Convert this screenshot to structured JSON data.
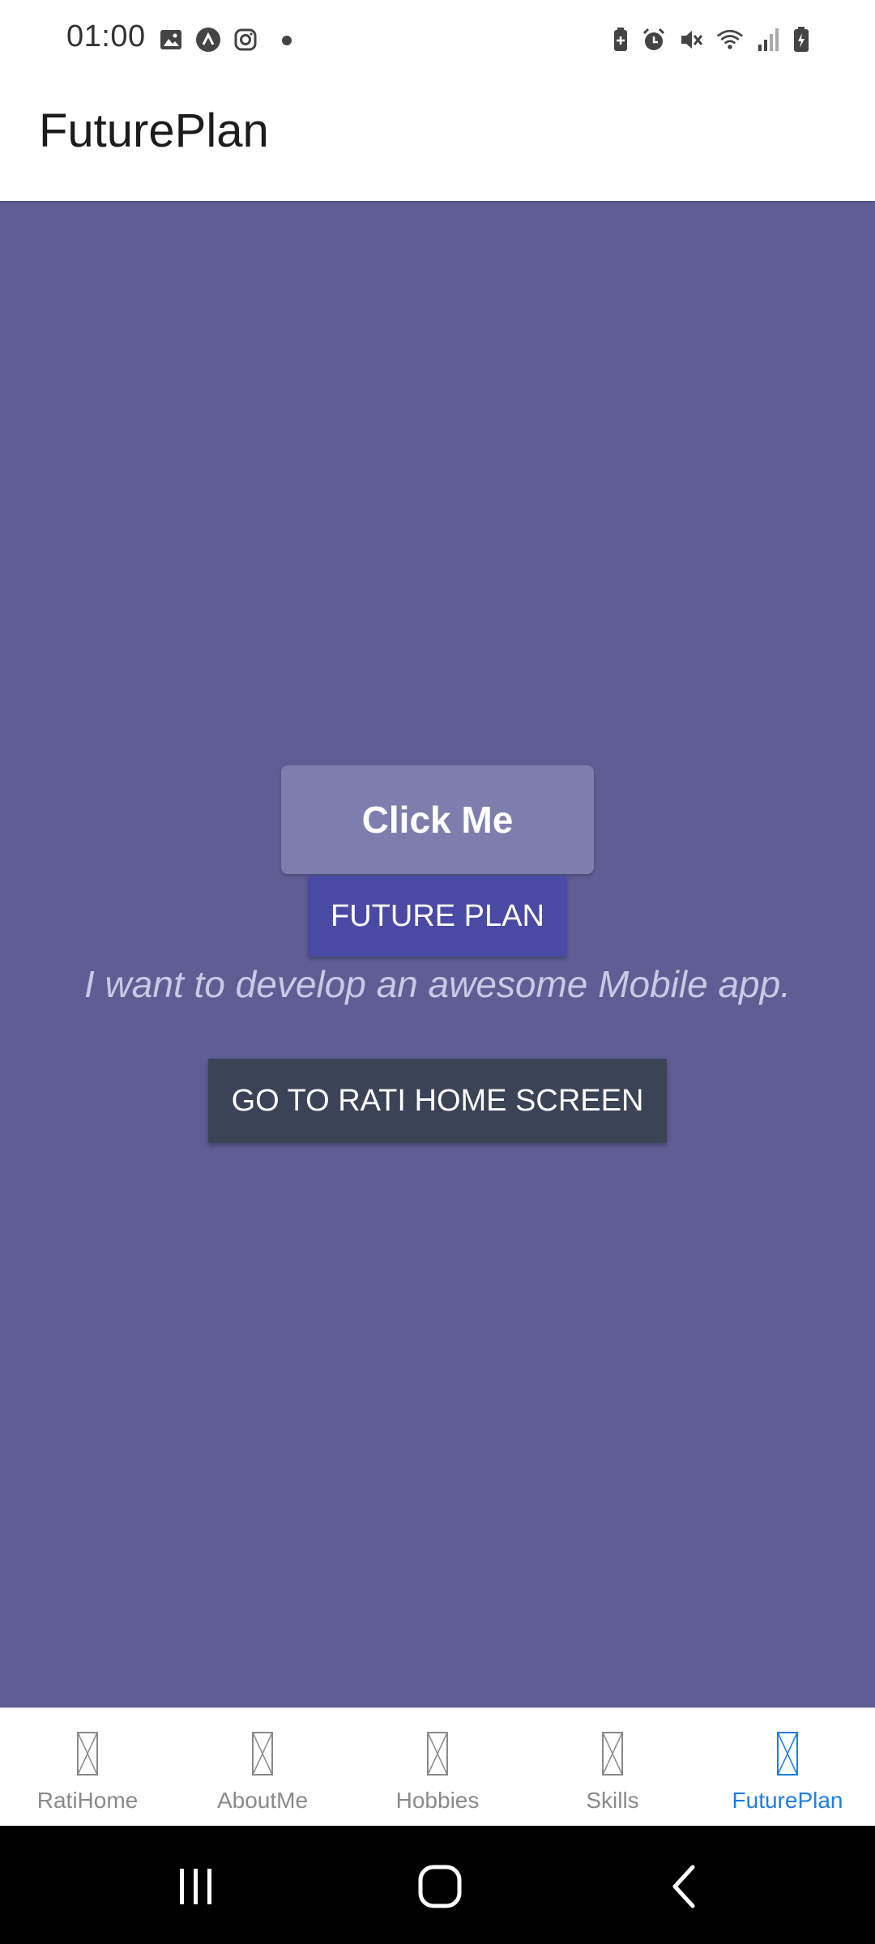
{
  "status_bar": {
    "time": "01:00"
  },
  "app_bar": {
    "title": "FuturePlan"
  },
  "main": {
    "click_me_label": "Click Me",
    "future_plan_label": "FUTURE PLAN",
    "plan_text": "I want to develop an awesome Mobile app.",
    "home_button_label": "GO TO RATI HOME SCREEN"
  },
  "tabs": [
    {
      "label": "RatiHome",
      "active": false
    },
    {
      "label": "AboutMe",
      "active": false
    },
    {
      "label": "Hobbies",
      "active": false
    },
    {
      "label": "Skills",
      "active": false
    },
    {
      "label": "FuturePlan",
      "active": true
    }
  ],
  "colors": {
    "content_bg": "#5e5e94",
    "click_me_bg": "#7e7eae",
    "future_plan_bg": "#4a4aa4",
    "home_button_bg": "#3b4356",
    "active_tab": "#1f7de0",
    "inactive_tab": "#8a8a8a"
  },
  "icons": {
    "tab_icon": "missing-glyph-icon",
    "status": [
      "gallery-icon",
      "app-circle-icon",
      "instagram-icon",
      "notification-dot",
      "battery-saver-icon",
      "alarm-icon",
      "mute-icon",
      "wifi-icon",
      "signal-icon",
      "battery-icon"
    ]
  }
}
